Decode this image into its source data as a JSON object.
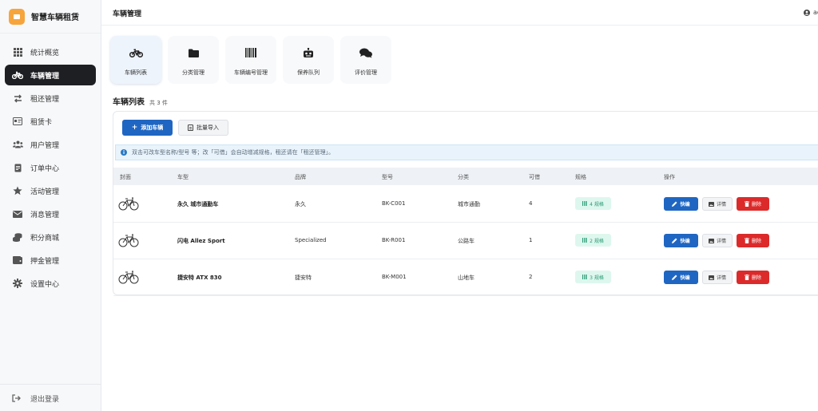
{
  "app": {
    "name": "智慧车辆租赁"
  },
  "sidebar": {
    "items": [
      {
        "label": "统计概览",
        "icon": "grid-icon"
      },
      {
        "label": "车辆管理",
        "icon": "bicycle-icon",
        "active": true
      },
      {
        "label": "租还管理",
        "icon": "swap-icon"
      },
      {
        "label": "租赁卡",
        "icon": "id-card-icon"
      },
      {
        "label": "用户管理",
        "icon": "users-icon"
      },
      {
        "label": "订单中心",
        "icon": "document-icon"
      },
      {
        "label": "活动管理",
        "icon": "star-icon"
      },
      {
        "label": "消息管理",
        "icon": "envelope-icon"
      },
      {
        "label": "积分商城",
        "icon": "coins-icon"
      },
      {
        "label": "押金管理",
        "icon": "wallet-icon"
      },
      {
        "label": "设置中心",
        "icon": "gear-icon"
      }
    ],
    "logout": "退出登录"
  },
  "header": {
    "title": "车辆管理",
    "user": "ad"
  },
  "tiles": [
    {
      "label": "车辆列表",
      "icon": "bicycle-icon",
      "active": true
    },
    {
      "label": "分类管理",
      "icon": "folder-icon"
    },
    {
      "label": "车辆编号管理",
      "icon": "barcode-icon"
    },
    {
      "label": "保养队列",
      "icon": "robot-icon"
    },
    {
      "label": "评价管理",
      "icon": "comments-icon"
    }
  ],
  "list": {
    "title": "车辆列表",
    "count": "共 3 件",
    "add_label": "添加车辆",
    "import_label": "批量导入",
    "info": "双击可改车型名称/型号 等；改「可借」会自动增减规格，租还请在「租还管理」。"
  },
  "table": {
    "headers": [
      "封面",
      "车型",
      "品牌",
      "型号",
      "分类",
      "可借",
      "规格",
      "操作"
    ],
    "rows": [
      {
        "model": "永久 城市通勤车",
        "brand": "永久",
        "code": "BK-C001",
        "category": "城市通勤",
        "available": "4",
        "spec": "4 规格"
      },
      {
        "model": "闪电 Allez Sport",
        "brand": "Specialized",
        "code": "BK-R001",
        "category": "公路车",
        "available": "1",
        "spec": "2 规格"
      },
      {
        "model": "捷安特 ATX 830",
        "brand": "捷安特",
        "code": "BK-M001",
        "category": "山地车",
        "available": "2",
        "spec": "3 规格"
      }
    ],
    "actions": {
      "edit": "快编",
      "detail": "详情",
      "delete": "删除"
    }
  },
  "colors": {
    "primary": "#1f66c2",
    "danger": "#dc2a2a",
    "sidebar_active": "#1e1f23",
    "brand": "#f6a53c",
    "spec": "#2b9b75"
  }
}
